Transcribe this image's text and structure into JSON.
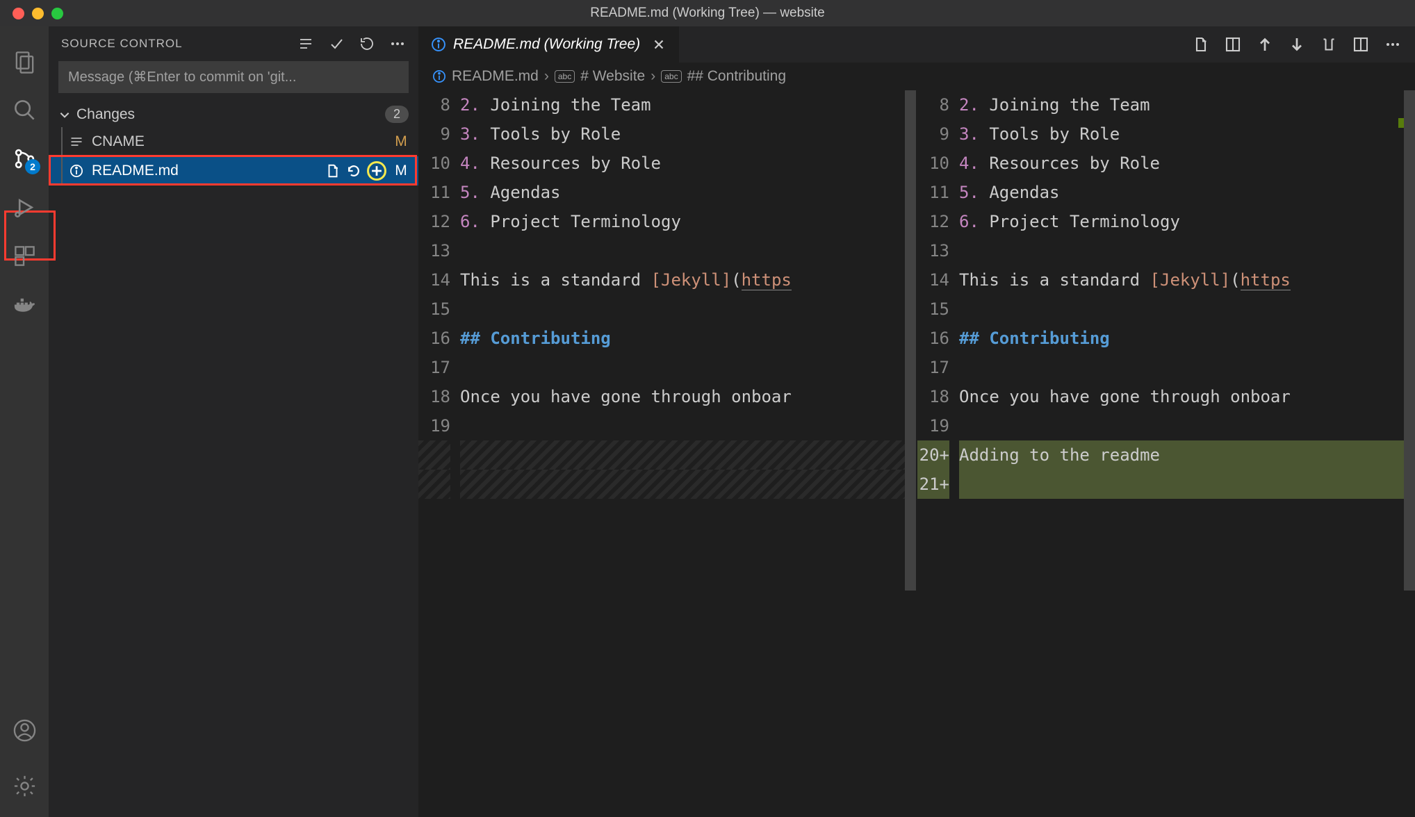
{
  "window": {
    "title": "README.md (Working Tree) — website"
  },
  "activity_bar": {
    "scm_badge": "2"
  },
  "sidebar": {
    "title": "SOURCE CONTROL",
    "commit_placeholder": "Message (⌘Enter to commit on 'git...",
    "changes_label": "Changes",
    "changes_count": "2",
    "files": [
      {
        "name": "CNAME",
        "status": "M",
        "selected": false
      },
      {
        "name": "README.md",
        "status": "M",
        "selected": true
      }
    ]
  },
  "tab": {
    "label": "README.md (Working Tree)"
  },
  "breadcrumb": {
    "file": "README.md",
    "sec1": "# Website",
    "sec2": "## Contributing"
  },
  "diff": {
    "left": [
      {
        "n": "8",
        "type": "li",
        "num": "2.",
        "text": " Joining the Team"
      },
      {
        "n": "9",
        "type": "li",
        "num": "3.",
        "text": " Tools by Role"
      },
      {
        "n": "10",
        "type": "li",
        "num": "4.",
        "text": " Resources by Role"
      },
      {
        "n": "11",
        "type": "li",
        "num": "5.",
        "text": " Agendas"
      },
      {
        "n": "12",
        "type": "li",
        "num": "6.",
        "text": " Project Terminology"
      },
      {
        "n": "13",
        "type": "blank"
      },
      {
        "n": "14",
        "type": "jekyll"
      },
      {
        "n": "15",
        "type": "blank"
      },
      {
        "n": "16",
        "type": "head",
        "text": "## Contributing"
      },
      {
        "n": "17",
        "type": "blank"
      },
      {
        "n": "18",
        "type": "plain",
        "text": "Once you have gone through onboar"
      },
      {
        "n": "19",
        "type": "blank"
      },
      {
        "n": "",
        "type": "hatch"
      },
      {
        "n": "",
        "type": "hatch"
      }
    ],
    "right": [
      {
        "n": "8",
        "type": "li",
        "num": "2.",
        "text": " Joining the Team"
      },
      {
        "n": "9",
        "type": "li",
        "num": "3.",
        "text": " Tools by Role"
      },
      {
        "n": "10",
        "type": "li",
        "num": "4.",
        "text": " Resources by Role"
      },
      {
        "n": "11",
        "type": "li",
        "num": "5.",
        "text": " Agendas"
      },
      {
        "n": "12",
        "type": "li",
        "num": "6.",
        "text": " Project Terminology"
      },
      {
        "n": "13",
        "type": "blank"
      },
      {
        "n": "14",
        "type": "jekyll"
      },
      {
        "n": "15",
        "type": "blank"
      },
      {
        "n": "16",
        "type": "head",
        "text": "## Contributing"
      },
      {
        "n": "17",
        "type": "blank"
      },
      {
        "n": "18",
        "type": "plain",
        "text": "Once you have gone through onboar"
      },
      {
        "n": "19",
        "type": "blank"
      },
      {
        "n": "20+",
        "type": "add",
        "text": "Adding to the readme"
      },
      {
        "n": "21+",
        "type": "add",
        "text": ""
      }
    ],
    "jekyll_prefix": "This is a standard ",
    "jekyll_link": "[Jekyll]",
    "jekyll_paren": "(",
    "jekyll_url": "https"
  }
}
